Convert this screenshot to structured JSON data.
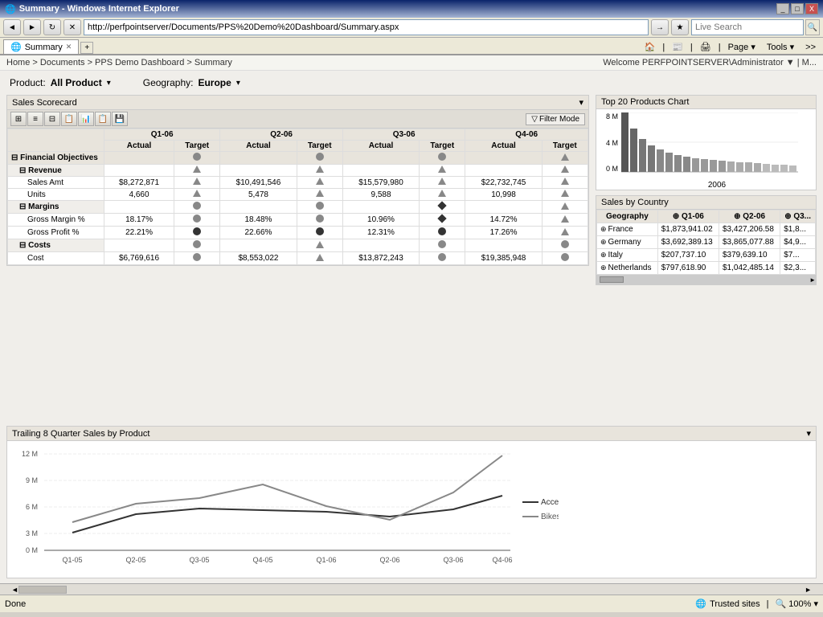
{
  "window": {
    "title": "Summary - Windows Internet Explorer",
    "controls": [
      "_",
      "□",
      "X"
    ]
  },
  "browser": {
    "address": "http://perfpointserver/Documents/PPS%20Demo%20Dashboard/Summary.aspx",
    "tab_label": "Summary",
    "live_search_label": "Live Search",
    "nav_back": "◄",
    "nav_forward": "►",
    "refresh": "↻",
    "search_icon": "🔍"
  },
  "toolbar2": {
    "home": "🏠",
    "favorites": "★",
    "feeds": "📰",
    "print": "🖨",
    "page": "Page",
    "tools": "Tools"
  },
  "breadcrumb": {
    "path": "Home > Documents > PPS Demo Dashboard > Summary",
    "welcome": "Welcome PERFPOINTSERVER\\Administrator ▼  |  M..."
  },
  "filters": {
    "product_label": "Product:",
    "product_value": "All Product",
    "geography_label": "Geography:",
    "geography_value": "Europe"
  },
  "scorecard": {
    "title": "Sales Scorecard",
    "filter_mode": "Filter Mode",
    "toolbar_icons": [
      "⊞",
      "≡",
      "⊟",
      "📋",
      "📊",
      "📋",
      "💾"
    ],
    "columns": {
      "q1": "Q1-06",
      "q2": "Q2-06",
      "q3": "Q3-06",
      "q4": "Q4-06",
      "actual": "Actual",
      "target": "Target"
    },
    "rows": [
      {
        "type": "section",
        "label": "Financial Objectives",
        "q1a": "",
        "q1t": "circle-gray",
        "q2a": "",
        "q2t": "circle-gray",
        "q3a": "",
        "q3t": "circle-gray",
        "q4a": "",
        "q4t": "triangle-up"
      },
      {
        "type": "subsection",
        "label": "Revenue",
        "q1a": "",
        "q1t": "triangle-up",
        "q2a": "",
        "q2t": "triangle-up",
        "q3a": "",
        "q3t": "triangle-up",
        "q4a": "",
        "q4t": "triangle-up"
      },
      {
        "type": "data",
        "label": "Sales Amt",
        "q1a": "$8,272,871",
        "q1t": "triangle-up",
        "q2a": "$10,491,546",
        "q2t": "triangle-up",
        "q3a": "$15,579,980",
        "q3t": "triangle-up",
        "q4a": "$22,732,745",
        "q4t": "triangle-up"
      },
      {
        "type": "data",
        "label": "Units",
        "q1a": "4,660",
        "q1t": "triangle-up",
        "q2a": "5,478",
        "q2t": "triangle-up",
        "q3a": "9,588",
        "q3t": "triangle-up",
        "q4a": "10,998",
        "q4t": "triangle-up"
      },
      {
        "type": "subsection",
        "label": "Margins",
        "q1a": "",
        "q1t": "circle-gray",
        "q2a": "",
        "q2t": "circle-gray",
        "q3a": "",
        "q3t": "diamond-dark",
        "q4a": "",
        "q4t": "triangle-up"
      },
      {
        "type": "data",
        "label": "Gross Margin %",
        "q1a": "18.17%",
        "q1t": "circle-gray",
        "q2a": "18.48%",
        "q2t": "circle-gray",
        "q3a": "10.96%",
        "q3t": "diamond-dark",
        "q4a": "14.72%",
        "q4t": "triangle-up"
      },
      {
        "type": "data",
        "label": "Gross Profit %",
        "q1a": "22.21%",
        "q1t": "circle-dark",
        "q2a": "22.66%",
        "q2t": "circle-dark",
        "q3a": "12.31%",
        "q3t": "circle-dark",
        "q4a": "17.26%",
        "q4t": "triangle-up"
      },
      {
        "type": "subsection",
        "label": "Costs",
        "q1a": "",
        "q1t": "circle-gray",
        "q2a": "",
        "q2t": "triangle-up",
        "q3a": "",
        "q3t": "circle-gray",
        "q4a": "",
        "q4t": "circle-gray"
      },
      {
        "type": "data",
        "label": "Cost",
        "q1a": "$6,769,616",
        "q1t": "circle-gray",
        "q2a": "$8,553,022",
        "q2t": "triangle-up",
        "q3a": "$13,872,243",
        "q3t": "circle-gray",
        "q4a": "$19,385,948",
        "q4t": "circle-gray"
      }
    ]
  },
  "top20_chart": {
    "title": "Top 20 Products Chart",
    "y_labels": [
      "8 M",
      "4 M",
      "0 M"
    ],
    "x_label": "2006",
    "bars": [
      100,
      72,
      55,
      45,
      38,
      33,
      29,
      26,
      24,
      22,
      20,
      19,
      18,
      17,
      16,
      15,
      14,
      13,
      12,
      11
    ]
  },
  "sales_by_country": {
    "title": "Sales by Country",
    "columns": [
      "Geography",
      "+ Q1-06",
      "+ Q2-06",
      "+ Q3..."
    ],
    "rows": [
      {
        "label": "France",
        "q1": "$1,873,941.02",
        "q2": "$3,427,206.58",
        "q3": "$1,8..."
      },
      {
        "label": "Germany",
        "q1": "$3,692,389.13",
        "q2": "$3,865,077.88",
        "q3": "$4,9..."
      },
      {
        "label": "Italy",
        "q1": "$207,737.10",
        "q2": "$379,639.10",
        "q3": "$7..."
      },
      {
        "label": "Netherlands",
        "q1": "$797,618.90",
        "q2": "$1,042,485.14",
        "q3": "$2,3..."
      }
    ]
  },
  "trailing_chart": {
    "title": "Trailing 8 Quarter Sales by Product",
    "y_labels": [
      "12 M",
      "9 M",
      "6 M",
      "3 M",
      "0 M"
    ],
    "x_labels": [
      "Q1-05",
      "Q2-05",
      "Q3-05",
      "Q4-05",
      "Q1-06",
      "Q2-06",
      "Q3-06",
      "Q4-06"
    ],
    "series": [
      {
        "name": "Accessories",
        "color": "#333",
        "points": [
          2.2,
          4.5,
          5.2,
          5.0,
          4.8,
          4.2,
          5.1,
          6.8
        ]
      },
      {
        "name": "Bikes",
        "color": "#888",
        "points": [
          3.5,
          5.8,
          6.5,
          8.2,
          5.5,
          3.8,
          7.2,
          11.8
        ]
      }
    ]
  },
  "status": {
    "left": "Done",
    "zone": "Trusted sites",
    "zoom": "100%"
  }
}
